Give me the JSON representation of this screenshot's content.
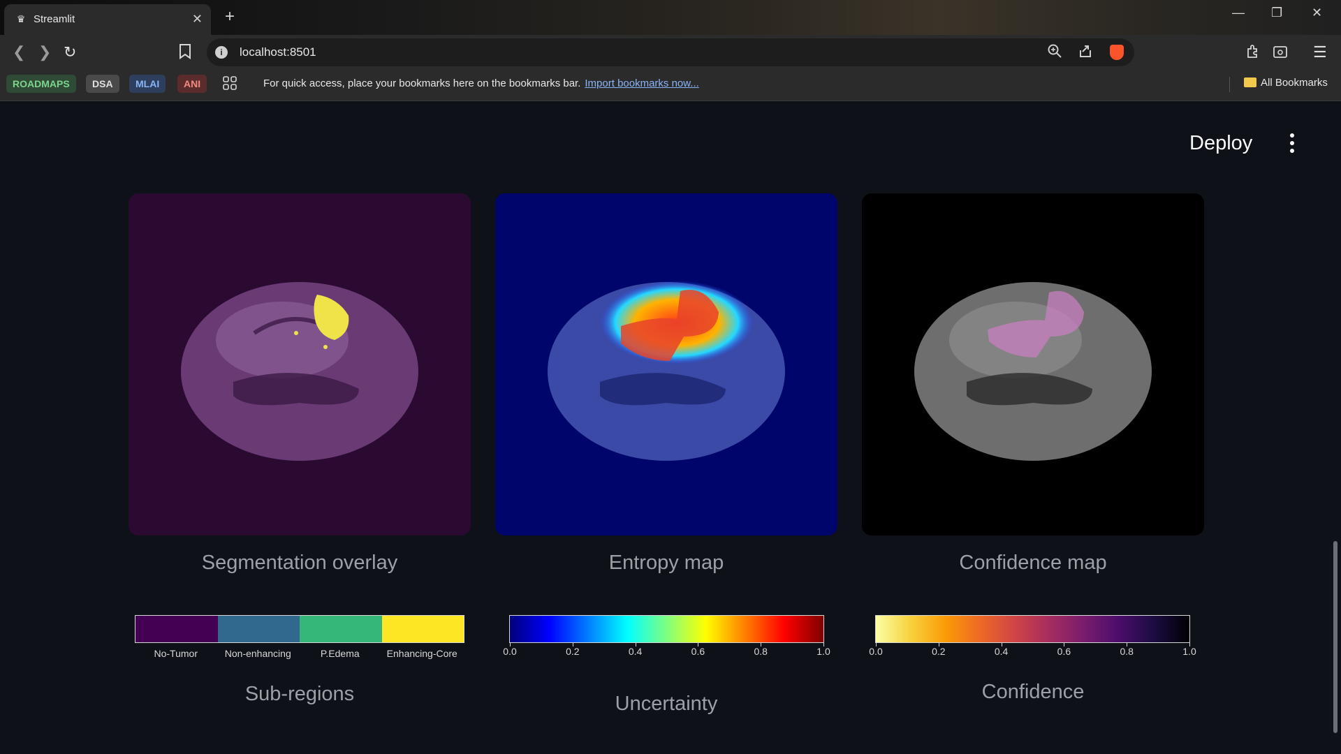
{
  "browser": {
    "tab_title": "Streamlit",
    "url": "localhost:8501",
    "bookmark_chips": [
      {
        "label": "ROADMAPS",
        "bg": "#2f4a35",
        "fg": "#7ed48e"
      },
      {
        "label": "DSA",
        "bg": "#4a4a4a",
        "fg": "#e0e0e0"
      },
      {
        "label": "MLAI",
        "bg": "#2e3f5e",
        "fg": "#8ab4f8"
      },
      {
        "label": "ANI",
        "bg": "#5a2c2c",
        "fg": "#f28b82"
      }
    ],
    "bookmarks_message": "For quick access, place your bookmarks here on the bookmarks bar.",
    "import_link": "Import bookmarks now...",
    "all_bookmarks": "All Bookmarks"
  },
  "header": {
    "deploy_label": "Deploy"
  },
  "panels": [
    {
      "caption": "Segmentation overlay",
      "background": "#2a0a30",
      "brain_tint": "#6a3a75"
    },
    {
      "caption": "Entropy map",
      "background": "#00056b",
      "brain_tint": "#3a4aa6"
    },
    {
      "caption": "Confidence map",
      "background": "#000000",
      "brain_tint": "#6e6e6e"
    }
  ],
  "legends": {
    "subregions": {
      "title": "Sub-regions",
      "items": [
        {
          "label": "No-Tumor",
          "color": "#440154"
        },
        {
          "label": "Non-enhancing",
          "color": "#31688e"
        },
        {
          "label": "P.Edema",
          "color": "#35b779"
        },
        {
          "label": "Enhancing-Core",
          "color": "#fde725"
        }
      ]
    },
    "uncertainty": {
      "title": "Uncertainty",
      "colormap": "jet",
      "ticks": [
        "0.0",
        "0.2",
        "0.4",
        "0.6",
        "0.8",
        "1.0"
      ]
    },
    "confidence": {
      "title": "Confidence",
      "colormap": "inferno_r",
      "ticks": [
        "0.0",
        "0.2",
        "0.4",
        "0.6",
        "0.8",
        "1.0"
      ]
    }
  }
}
